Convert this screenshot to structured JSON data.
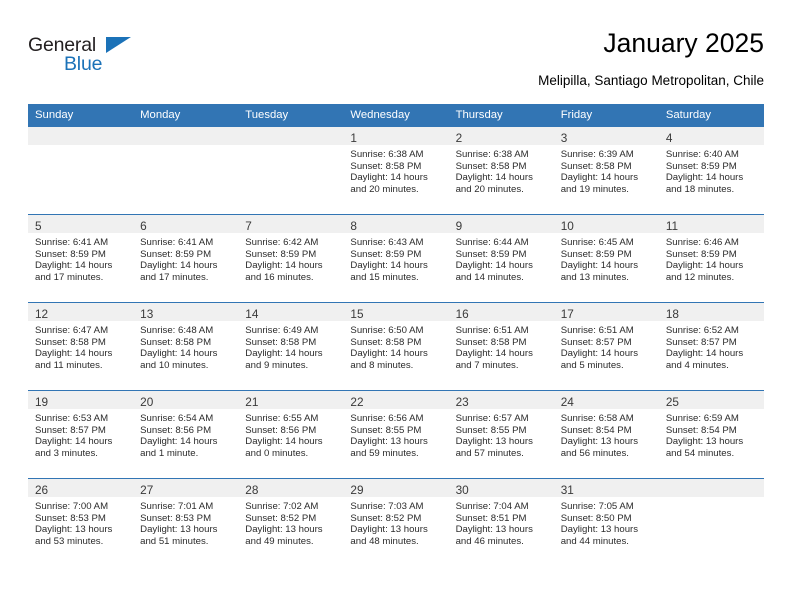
{
  "brand": {
    "logo_line1": "General",
    "logo_line2": "Blue",
    "logo_icon": "triangle-icon",
    "accent_color": "#1b72b8"
  },
  "header": {
    "title": "January 2025",
    "subtitle": "Melipilla, Santiago Metropolitan, Chile"
  },
  "calendar": {
    "header_bg": "#3275b4",
    "daynum_bg": "#f0f0f0",
    "weekday_headers": [
      "Sunday",
      "Monday",
      "Tuesday",
      "Wednesday",
      "Thursday",
      "Friday",
      "Saturday"
    ],
    "weeks": [
      [
        {
          "day": ""
        },
        {
          "day": ""
        },
        {
          "day": ""
        },
        {
          "day": "1",
          "sunrise": "Sunrise: 6:38 AM",
          "sunset": "Sunset: 8:58 PM",
          "daylight_line1": "Daylight: 14 hours",
          "daylight_line2": "and 20 minutes."
        },
        {
          "day": "2",
          "sunrise": "Sunrise: 6:38 AM",
          "sunset": "Sunset: 8:58 PM",
          "daylight_line1": "Daylight: 14 hours",
          "daylight_line2": "and 20 minutes."
        },
        {
          "day": "3",
          "sunrise": "Sunrise: 6:39 AM",
          "sunset": "Sunset: 8:58 PM",
          "daylight_line1": "Daylight: 14 hours",
          "daylight_line2": "and 19 minutes."
        },
        {
          "day": "4",
          "sunrise": "Sunrise: 6:40 AM",
          "sunset": "Sunset: 8:59 PM",
          "daylight_line1": "Daylight: 14 hours",
          "daylight_line2": "and 18 minutes."
        }
      ],
      [
        {
          "day": "5",
          "sunrise": "Sunrise: 6:41 AM",
          "sunset": "Sunset: 8:59 PM",
          "daylight_line1": "Daylight: 14 hours",
          "daylight_line2": "and 17 minutes."
        },
        {
          "day": "6",
          "sunrise": "Sunrise: 6:41 AM",
          "sunset": "Sunset: 8:59 PM",
          "daylight_line1": "Daylight: 14 hours",
          "daylight_line2": "and 17 minutes."
        },
        {
          "day": "7",
          "sunrise": "Sunrise: 6:42 AM",
          "sunset": "Sunset: 8:59 PM",
          "daylight_line1": "Daylight: 14 hours",
          "daylight_line2": "and 16 minutes."
        },
        {
          "day": "8",
          "sunrise": "Sunrise: 6:43 AM",
          "sunset": "Sunset: 8:59 PM",
          "daylight_line1": "Daylight: 14 hours",
          "daylight_line2": "and 15 minutes."
        },
        {
          "day": "9",
          "sunrise": "Sunrise: 6:44 AM",
          "sunset": "Sunset: 8:59 PM",
          "daylight_line1": "Daylight: 14 hours",
          "daylight_line2": "and 14 minutes."
        },
        {
          "day": "10",
          "sunrise": "Sunrise: 6:45 AM",
          "sunset": "Sunset: 8:59 PM",
          "daylight_line1": "Daylight: 14 hours",
          "daylight_line2": "and 13 minutes."
        },
        {
          "day": "11",
          "sunrise": "Sunrise: 6:46 AM",
          "sunset": "Sunset: 8:59 PM",
          "daylight_line1": "Daylight: 14 hours",
          "daylight_line2": "and 12 minutes."
        }
      ],
      [
        {
          "day": "12",
          "sunrise": "Sunrise: 6:47 AM",
          "sunset": "Sunset: 8:58 PM",
          "daylight_line1": "Daylight: 14 hours",
          "daylight_line2": "and 11 minutes."
        },
        {
          "day": "13",
          "sunrise": "Sunrise: 6:48 AM",
          "sunset": "Sunset: 8:58 PM",
          "daylight_line1": "Daylight: 14 hours",
          "daylight_line2": "and 10 minutes."
        },
        {
          "day": "14",
          "sunrise": "Sunrise: 6:49 AM",
          "sunset": "Sunset: 8:58 PM",
          "daylight_line1": "Daylight: 14 hours",
          "daylight_line2": "and 9 minutes."
        },
        {
          "day": "15",
          "sunrise": "Sunrise: 6:50 AM",
          "sunset": "Sunset: 8:58 PM",
          "daylight_line1": "Daylight: 14 hours",
          "daylight_line2": "and 8 minutes."
        },
        {
          "day": "16",
          "sunrise": "Sunrise: 6:51 AM",
          "sunset": "Sunset: 8:58 PM",
          "daylight_line1": "Daylight: 14 hours",
          "daylight_line2": "and 7 minutes."
        },
        {
          "day": "17",
          "sunrise": "Sunrise: 6:51 AM",
          "sunset": "Sunset: 8:57 PM",
          "daylight_line1": "Daylight: 14 hours",
          "daylight_line2": "and 5 minutes."
        },
        {
          "day": "18",
          "sunrise": "Sunrise: 6:52 AM",
          "sunset": "Sunset: 8:57 PM",
          "daylight_line1": "Daylight: 14 hours",
          "daylight_line2": "and 4 minutes."
        }
      ],
      [
        {
          "day": "19",
          "sunrise": "Sunrise: 6:53 AM",
          "sunset": "Sunset: 8:57 PM",
          "daylight_line1": "Daylight: 14 hours",
          "daylight_line2": "and 3 minutes."
        },
        {
          "day": "20",
          "sunrise": "Sunrise: 6:54 AM",
          "sunset": "Sunset: 8:56 PM",
          "daylight_line1": "Daylight: 14 hours",
          "daylight_line2": "and 1 minute."
        },
        {
          "day": "21",
          "sunrise": "Sunrise: 6:55 AM",
          "sunset": "Sunset: 8:56 PM",
          "daylight_line1": "Daylight: 14 hours",
          "daylight_line2": "and 0 minutes."
        },
        {
          "day": "22",
          "sunrise": "Sunrise: 6:56 AM",
          "sunset": "Sunset: 8:55 PM",
          "daylight_line1": "Daylight: 13 hours",
          "daylight_line2": "and 59 minutes."
        },
        {
          "day": "23",
          "sunrise": "Sunrise: 6:57 AM",
          "sunset": "Sunset: 8:55 PM",
          "daylight_line1": "Daylight: 13 hours",
          "daylight_line2": "and 57 minutes."
        },
        {
          "day": "24",
          "sunrise": "Sunrise: 6:58 AM",
          "sunset": "Sunset: 8:54 PM",
          "daylight_line1": "Daylight: 13 hours",
          "daylight_line2": "and 56 minutes."
        },
        {
          "day": "25",
          "sunrise": "Sunrise: 6:59 AM",
          "sunset": "Sunset: 8:54 PM",
          "daylight_line1": "Daylight: 13 hours",
          "daylight_line2": "and 54 minutes."
        }
      ],
      [
        {
          "day": "26",
          "sunrise": "Sunrise: 7:00 AM",
          "sunset": "Sunset: 8:53 PM",
          "daylight_line1": "Daylight: 13 hours",
          "daylight_line2": "and 53 minutes."
        },
        {
          "day": "27",
          "sunrise": "Sunrise: 7:01 AM",
          "sunset": "Sunset: 8:53 PM",
          "daylight_line1": "Daylight: 13 hours",
          "daylight_line2": "and 51 minutes."
        },
        {
          "day": "28",
          "sunrise": "Sunrise: 7:02 AM",
          "sunset": "Sunset: 8:52 PM",
          "daylight_line1": "Daylight: 13 hours",
          "daylight_line2": "and 49 minutes."
        },
        {
          "day": "29",
          "sunrise": "Sunrise: 7:03 AM",
          "sunset": "Sunset: 8:52 PM",
          "daylight_line1": "Daylight: 13 hours",
          "daylight_line2": "and 48 minutes."
        },
        {
          "day": "30",
          "sunrise": "Sunrise: 7:04 AM",
          "sunset": "Sunset: 8:51 PM",
          "daylight_line1": "Daylight: 13 hours",
          "daylight_line2": "and 46 minutes."
        },
        {
          "day": "31",
          "sunrise": "Sunrise: 7:05 AM",
          "sunset": "Sunset: 8:50 PM",
          "daylight_line1": "Daylight: 13 hours",
          "daylight_line2": "and 44 minutes."
        },
        {
          "day": ""
        }
      ]
    ]
  }
}
